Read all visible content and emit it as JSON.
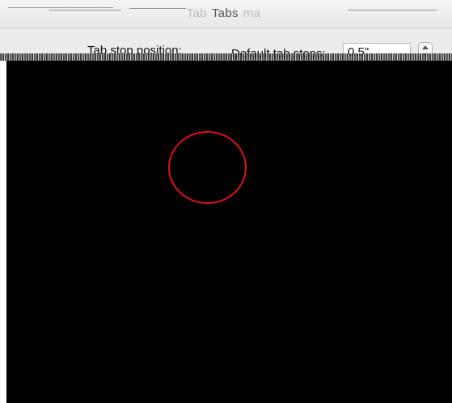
{
  "window": {
    "title": "Tabs",
    "title_obscured_prefix": "Tab",
    "title_obscured_suffix": "ma"
  },
  "tabs_sheet": {
    "tab_stop_position_label": "Tab stop position:",
    "default_tab_stops_label": "Default tab stops:",
    "default_tab_stops_value": "0.5\"",
    "stepper_icon": "stepper-arrows-icon"
  },
  "overlay": {
    "panel_color": "#000000",
    "circle_color": "#e01010"
  }
}
